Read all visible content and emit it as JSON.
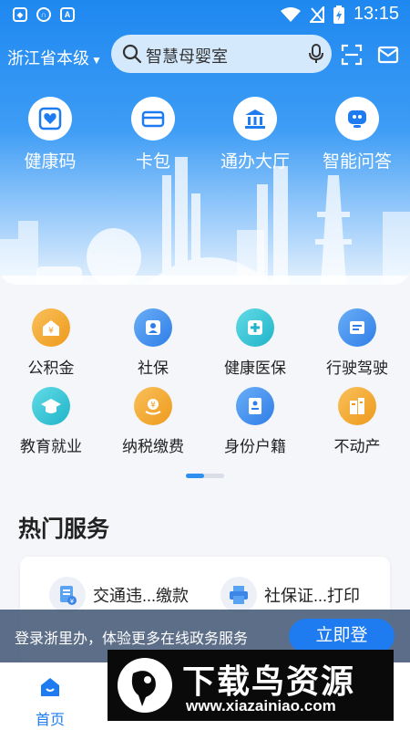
{
  "status_bar": {
    "time": "13:15",
    "left_icons": [
      "shield-app-icon",
      "headset-app-icon",
      "a-app-icon"
    ],
    "right_icons": [
      "wifi-icon",
      "no-signal-icon",
      "battery-charging-icon"
    ]
  },
  "header": {
    "region": "浙江省本级",
    "search_placeholder": "智慧母婴室"
  },
  "quick_actions": [
    {
      "label": "健康码",
      "icon": "health-code-icon"
    },
    {
      "label": "卡包",
      "icon": "card-wallet-icon"
    },
    {
      "label": "通办大厅",
      "icon": "government-hall-icon"
    },
    {
      "label": "智能问答",
      "icon": "robot-qa-icon"
    }
  ],
  "services": [
    {
      "label": "公积金",
      "icon": "housing-fund-icon",
      "color": "#f5a623"
    },
    {
      "label": "社保",
      "icon": "social-security-icon",
      "color": "#3b8ef0"
    },
    {
      "label": "健康医保",
      "icon": "medical-insurance-icon",
      "color": "#2ec4d6"
    },
    {
      "label": "行驶驾驶",
      "icon": "driving-license-icon",
      "color": "#3b8ef0"
    },
    {
      "label": "教育就业",
      "icon": "graduation-cap-icon",
      "color": "#2ec4d6"
    },
    {
      "label": "纳税缴费",
      "icon": "tax-payment-icon",
      "color": "#f5a623"
    },
    {
      "label": "身份户籍",
      "icon": "id-card-icon",
      "color": "#3b8ef0"
    },
    {
      "label": "不动产",
      "icon": "real-estate-icon",
      "color": "#f5a623"
    }
  ],
  "hot_services": {
    "title": "热门服务",
    "items": [
      {
        "label": "交通违...缴款",
        "icon": "traffic-fine-icon"
      },
      {
        "label": "社保证...打印",
        "icon": "printer-icon"
      }
    ]
  },
  "login_banner": {
    "text": "登录浙里办，体验更多在线政务服务",
    "button": "立即登"
  },
  "tabs": [
    {
      "label": "首页",
      "active": true
    }
  ],
  "watermark": {
    "title": "下载鸟资源",
    "url": "www.xiazainiao.com"
  },
  "colors": {
    "primary": "#1f7cf0",
    "orange": "#f5a623",
    "cyan": "#2ec4d6"
  }
}
